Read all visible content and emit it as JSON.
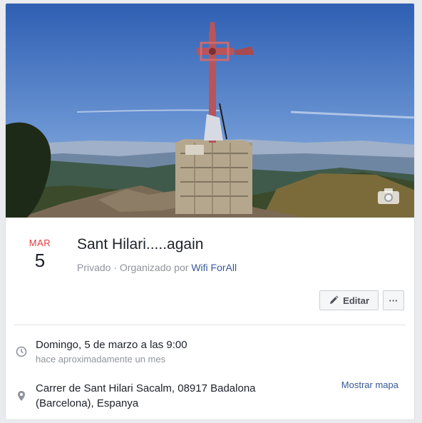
{
  "event": {
    "month": "MAR",
    "day": "5",
    "title": "Sant Hilari.....again",
    "privacy": "Privado · Organizado por",
    "organizer": "Wifi ForAll"
  },
  "actions": {
    "edit_label": "Editar",
    "more_label": "···"
  },
  "details": {
    "time_main": "Domingo, 5 de marzo a las 9:00",
    "time_sub": "hace aproximadamente un mes",
    "address_line1": "Carrer de Sant Hilari Sacalm, 08917 Badalona",
    "address_line2": "(Barcelona), Espanya",
    "map_link": "Mostrar mapa"
  },
  "colors": {
    "accent_red": "#e0393e",
    "link_blue": "#385898",
    "sky": "#4a76c4"
  },
  "icons": [
    "camera-icon",
    "pencil-icon",
    "clock-icon",
    "location-pin-icon"
  ]
}
